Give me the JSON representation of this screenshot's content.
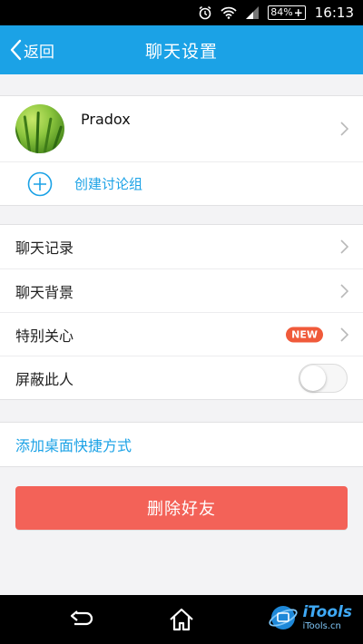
{
  "status_bar": {
    "battery_percent": "84%",
    "time": "16:13",
    "icons": [
      "alarm-icon",
      "wifi-icon",
      "signal-icon",
      "battery-charging-icon"
    ]
  },
  "header": {
    "back_label": "返回",
    "title": "聊天设置",
    "background": "#1ba2e6"
  },
  "profile": {
    "name": "Pradox",
    "create_group_label": "创建讨论组"
  },
  "settings": [
    {
      "label": "聊天记录"
    },
    {
      "label": "聊天背景"
    },
    {
      "label": "特别关心",
      "badge": "NEW"
    },
    {
      "label": "屏蔽此人",
      "toggle_on": false
    }
  ],
  "shortcut": {
    "label": "添加桌面快捷方式"
  },
  "actions": {
    "delete_label": "删除好友",
    "delete_color": "#f36258"
  },
  "watermark": {
    "title": "iTools",
    "subtitle": "iTools.cn"
  }
}
